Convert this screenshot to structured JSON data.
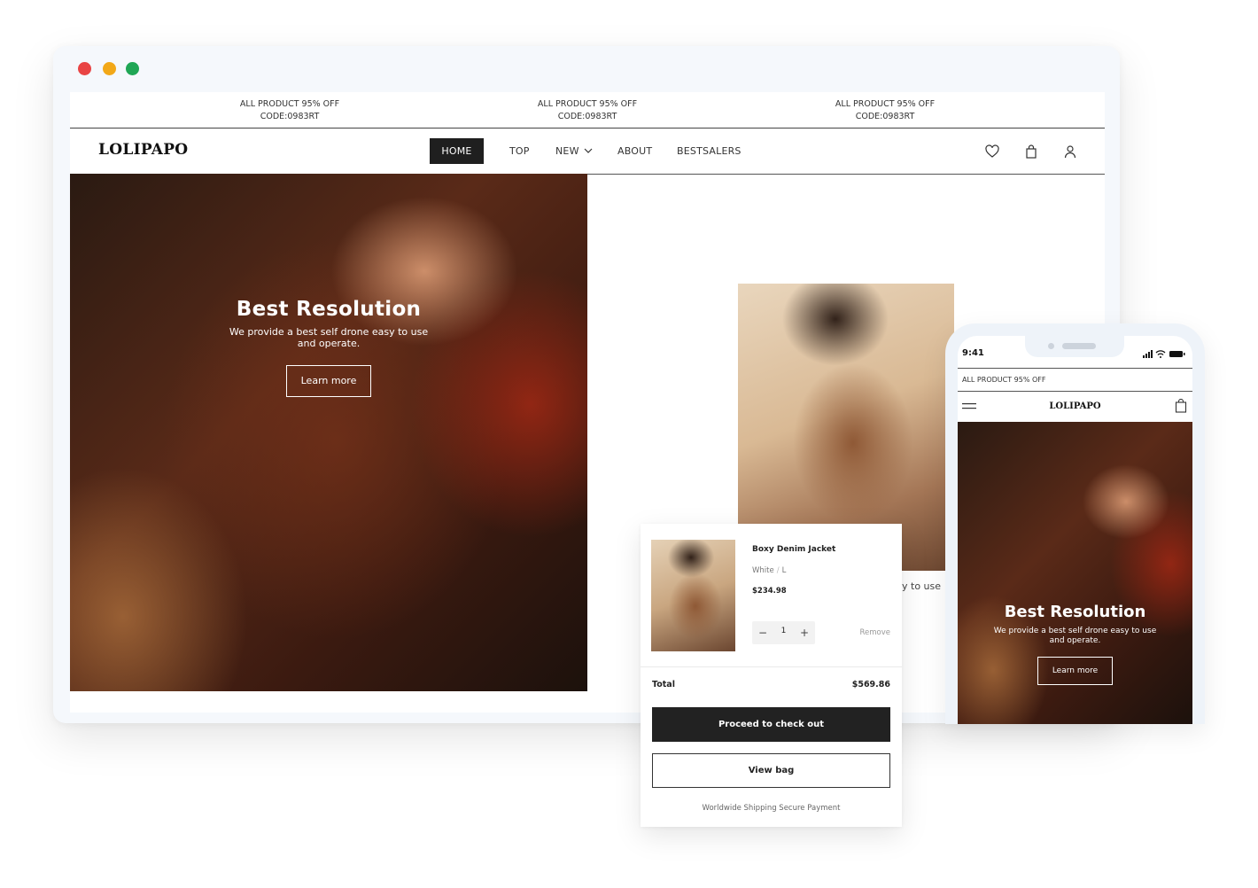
{
  "desktop": {
    "promos": [
      {
        "line1": "ALL PRODUCT 95% OFF",
        "line2": "CODE:0983RT"
      },
      {
        "line1": "ALL PRODUCT 95% OFF",
        "line2": "CODE:0983RT"
      },
      {
        "line1": "ALL PRODUCT 95% OFF",
        "line2": "CODE:0983RT"
      }
    ],
    "logo": "LOLIPAPO",
    "nav": [
      {
        "label": "HOME"
      },
      {
        "label": "TOP"
      },
      {
        "label": "NEW"
      },
      {
        "label": "ABOUT"
      },
      {
        "label": "BESTSALERS"
      }
    ],
    "hero": {
      "title": "Best Resolution",
      "subtitle": "We provide a best self drone easy to use and operate.",
      "button": "Learn more"
    },
    "side_text": "y to use"
  },
  "cart": {
    "product_name": "Boxy Denim Jacket",
    "color": "White",
    "size": "L",
    "price": "$234.98",
    "quantity": "1",
    "remove": "Remove",
    "total_label": "Total",
    "total_value": "$569.86",
    "checkout": "Proceed to check out",
    "view_bag": "View bag",
    "footer": "Worldwide Shipping  Secure Payment"
  },
  "phone": {
    "time": "9:41",
    "promo": "ALL PRODUCT 95% OFF",
    "logo": "LOLIPAPO",
    "hero": {
      "title": "Best Resolution",
      "subtitle": "We provide a best self drone easy to use and operate.",
      "button": "Learn more"
    }
  },
  "icons": {
    "wishlist": "heart-icon",
    "bag": "shopping-bag-icon",
    "account": "user-icon",
    "dropdown": "chevron-down-icon",
    "menu": "hamburger-menu-icon"
  },
  "colors": {
    "dark": "#1f1f1f",
    "window_close": "#e94444",
    "window_minimize": "#f2a818",
    "window_maximize": "#1fa655"
  }
}
